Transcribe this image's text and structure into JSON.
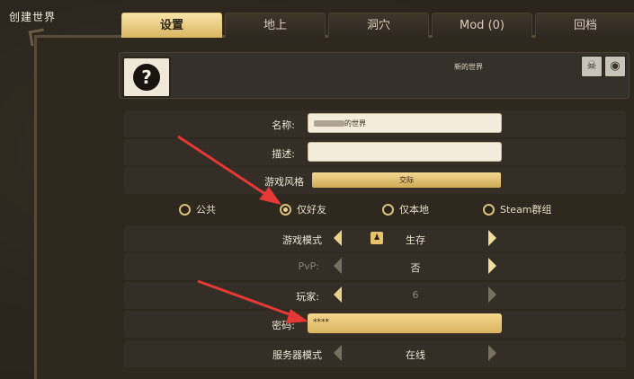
{
  "page": {
    "title": "创建世界"
  },
  "tabs": [
    {
      "label": "设置",
      "active": true
    },
    {
      "label": "地上",
      "active": false
    },
    {
      "label": "洞穴",
      "active": false
    },
    {
      "label": "Mod (0)",
      "active": false
    },
    {
      "label": "回档",
      "active": false
    }
  ],
  "header": {
    "world_name": "新的世界",
    "icons": [
      "ghost-icon",
      "globe-icon"
    ]
  },
  "form": {
    "name_label": "名称:",
    "name_value": "的世界",
    "desc_label": "描述:",
    "desc_value": "",
    "style_label": "游戏风格",
    "style_value": "交际",
    "privacy": {
      "options": [
        "公共",
        "仅好友",
        "仅本地",
        "Steam群组"
      ],
      "selected": "仅好友"
    },
    "game_mode_label": "游戏模式",
    "game_mode_value": "生存",
    "pvp_label": "PvP:",
    "pvp_value": "否",
    "players_label": "玩家:",
    "players_value": "6",
    "password_label": "密码:",
    "password_value": "****",
    "server_mode_label": "服务器模式",
    "server_mode_value": "在线"
  },
  "colors": {
    "accent": "#e8cf86",
    "annotation": "#e53935",
    "active_tab": "#f2d891"
  }
}
